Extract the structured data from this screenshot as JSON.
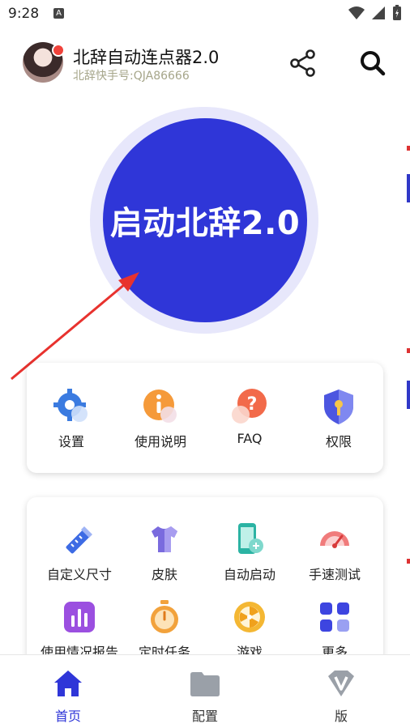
{
  "status": {
    "time": "9:28",
    "notif_letter": "A"
  },
  "header": {
    "title": "北辞自动连点器2.0",
    "subtitle": "北辞快手号:QJA86666"
  },
  "start_button": {
    "label": "启动北辞2.0",
    "color": "#2f36d8"
  },
  "quick_actions": [
    {
      "label": "设置",
      "icon": "gear-icon"
    },
    {
      "label": "使用说明",
      "icon": "info-icon"
    },
    {
      "label": "FAQ",
      "icon": "question-icon"
    },
    {
      "label": "权限",
      "icon": "shield-icon"
    }
  ],
  "tools": [
    {
      "label": "自定义尺寸",
      "icon": "ruler-pencil-icon"
    },
    {
      "label": "皮肤",
      "icon": "shirt-icon"
    },
    {
      "label": "自动启动",
      "icon": "phone-link-icon"
    },
    {
      "label": "手速测试",
      "icon": "speedometer-icon"
    },
    {
      "label": "使用情况报告",
      "icon": "bar-chart-icon"
    },
    {
      "label": "定时任务",
      "icon": "stopwatch-icon"
    },
    {
      "label": "游戏",
      "icon": "wheel-icon"
    },
    {
      "label": "更多",
      "icon": "grid-icon"
    }
  ],
  "nav": {
    "items": [
      {
        "label": "首页",
        "icon": "home-icon",
        "active": true
      },
      {
        "label": "配置",
        "icon": "folder-icon",
        "active": false
      },
      {
        "label": "版",
        "icon": "v-badge-icon",
        "active": false
      }
    ],
    "active_color": "#2f36d8",
    "inactive_color": "#333333"
  }
}
